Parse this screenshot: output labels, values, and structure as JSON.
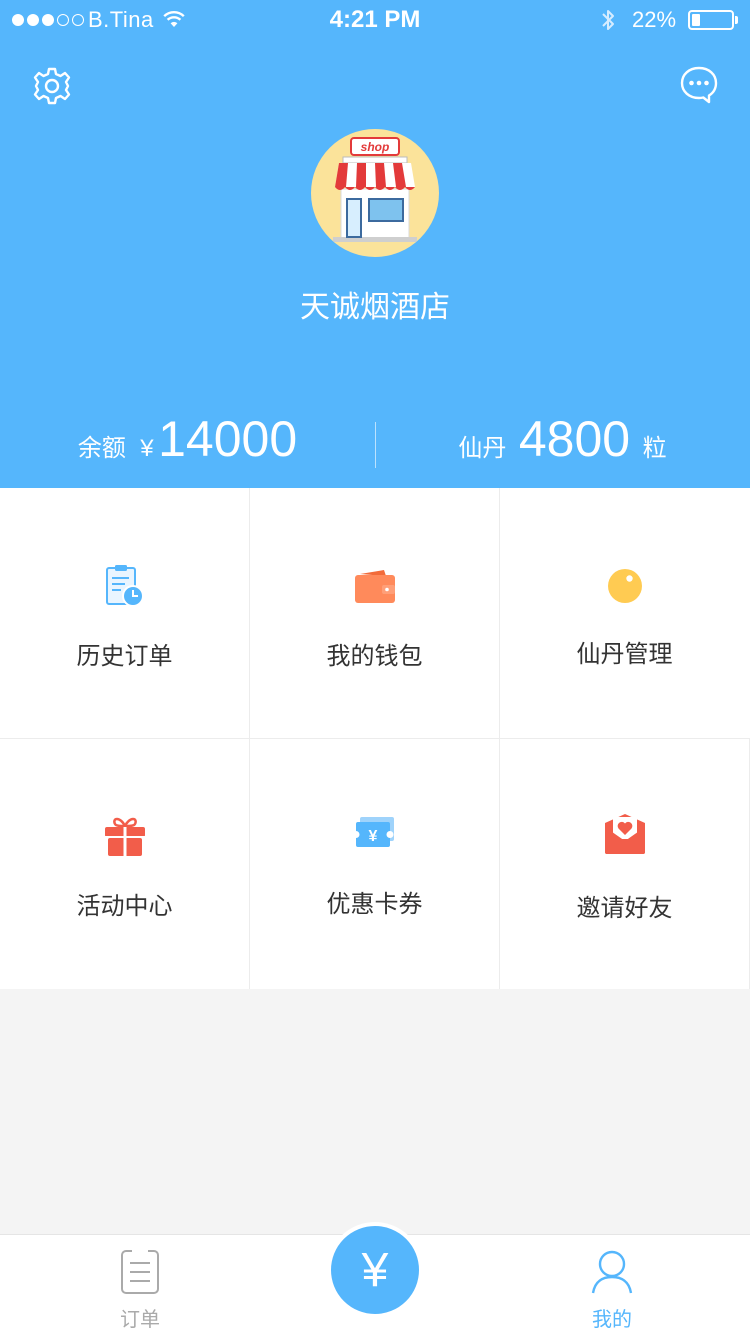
{
  "status_bar": {
    "carrier": "B.Tina",
    "time": "4:21 PM",
    "battery_percent_text": "22%",
    "battery_level": 0.22,
    "signal_bars_filled": 3,
    "signal_bars_total": 5
  },
  "header": {
    "settings_icon": "gear-icon",
    "message_icon": "chat-bubble-icon",
    "avatar_icon": "shop-storefront-icon",
    "shop_name": "天诚烟酒店",
    "balance": {
      "label": "余额",
      "currency": "¥",
      "value": "14000"
    },
    "points": {
      "label": "仙丹",
      "value": "4800",
      "unit": "粒"
    }
  },
  "grid": {
    "items": [
      {
        "label": "历史订单",
        "icon": "order-history-icon",
        "color": "#55b6fc"
      },
      {
        "label": "我的钱包",
        "icon": "wallet-icon",
        "color": "#ff8a5b"
      },
      {
        "label": "仙丹管理",
        "icon": "pill-icon",
        "color": "#ffcb52"
      },
      {
        "label": "活动中心",
        "icon": "gift-icon",
        "color": "#f25d4a"
      },
      {
        "label": "优惠卡券",
        "icon": "coupon-icon",
        "color": "#55b6fc"
      },
      {
        "label": "邀请好友",
        "icon": "invite-heart-icon",
        "color": "#f25d4a"
      }
    ]
  },
  "tabbar": {
    "orders": {
      "label": "订单",
      "icon": "document-icon",
      "color": "#aaaaaa"
    },
    "pay": {
      "glyph": "¥",
      "icon": "yuan-pay-icon",
      "color": "#55b6fc"
    },
    "mine": {
      "label": "我的",
      "icon": "user-icon",
      "color": "#55b6fc",
      "active": true
    }
  },
  "colors": {
    "primary": "#55b6fc",
    "text_dark": "#333333",
    "background": "#f4f4f4"
  }
}
